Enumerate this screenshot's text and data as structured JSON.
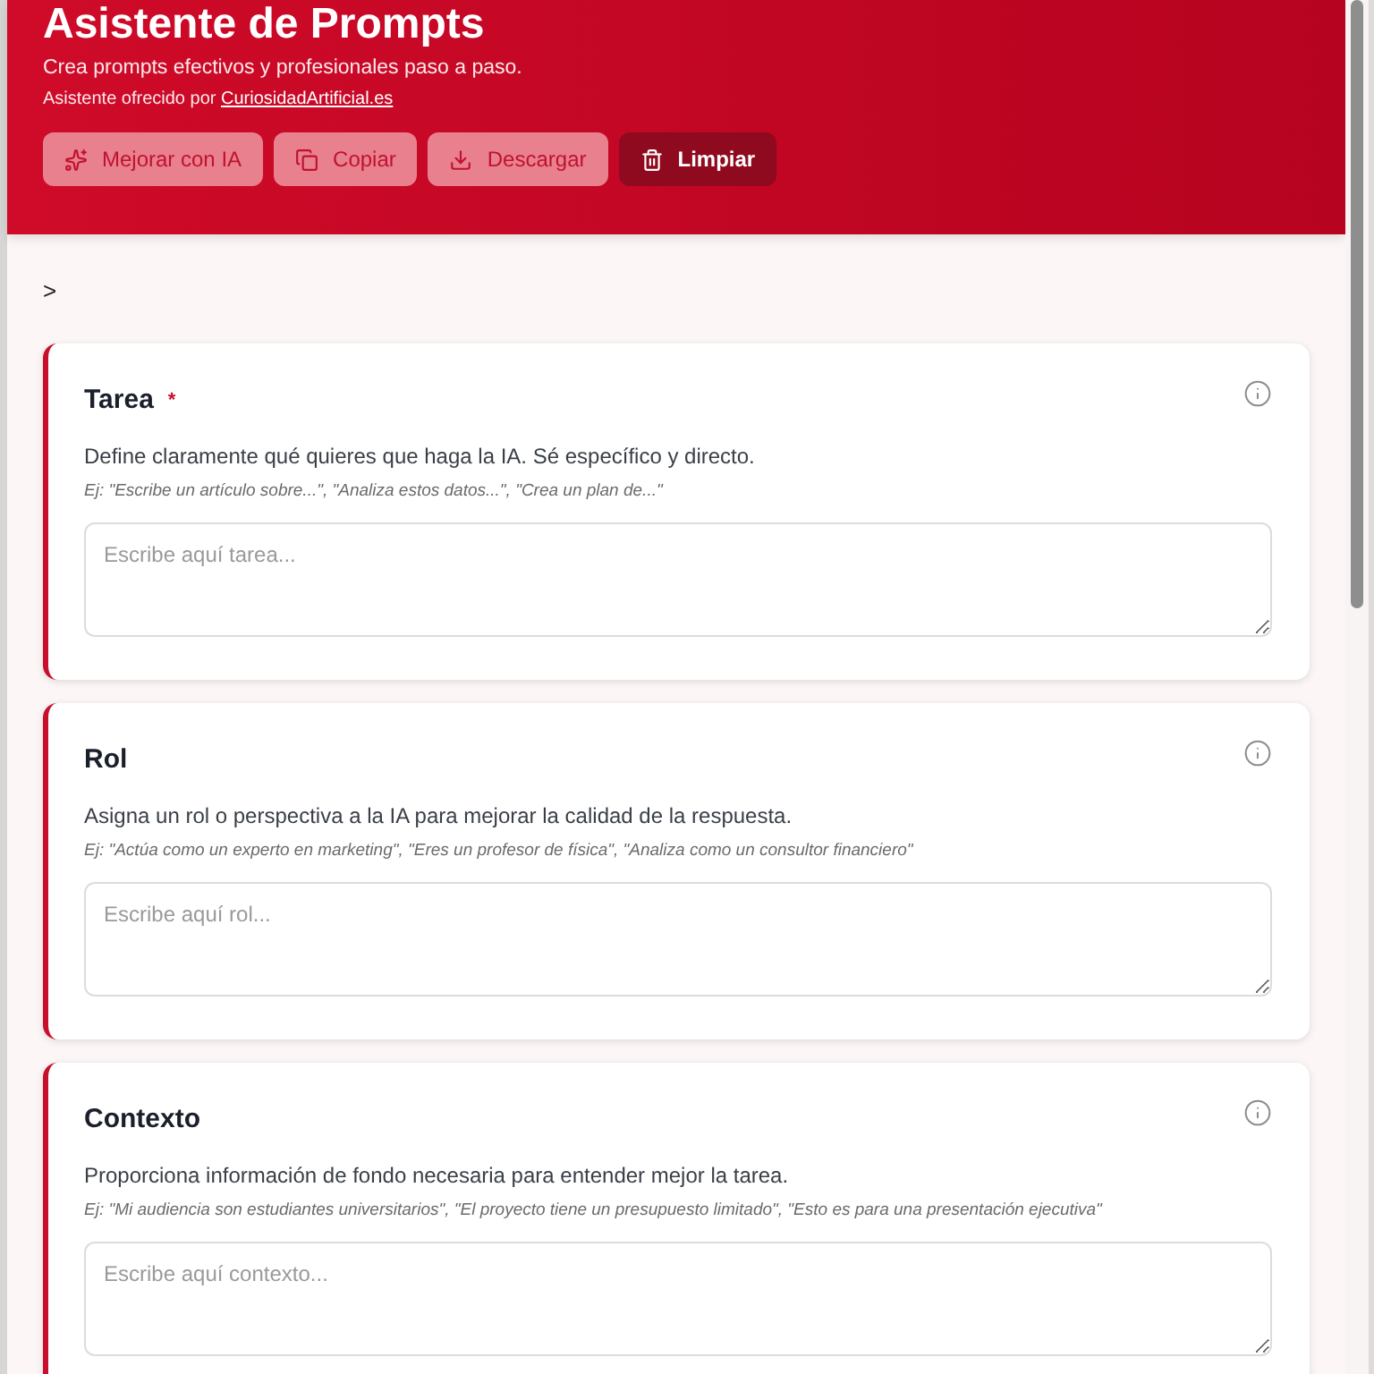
{
  "header": {
    "title": "Asistente de Prompts",
    "subtitle": "Crea prompts efectivos y profesionales paso a paso.",
    "credit": {
      "text": "Asistente ofrecido por",
      "link": "CuriosidadArtificial.es"
    },
    "buttons": [
      {
        "label": "Mejorar con IA",
        "kind": "sparkle"
      },
      {
        "label": "Copiar",
        "kind": "copy"
      },
      {
        "label": "Descargar",
        "kind": "download"
      },
      {
        "label": "Limpiar",
        "kind": "trash"
      }
    ]
  },
  "toggle": ">",
  "required_marker": "*",
  "sections": [
    {
      "title": "Tarea",
      "required": true,
      "description": "Define claramente qué quieres que haga la IA. Sé específico y directo.",
      "example": "Ej: \"Escribe un artículo sobre...\", \"Analiza estos datos...\", \"Crea un plan de...\"",
      "placeholder": "Escribe aquí tarea..."
    },
    {
      "title": "Rol",
      "required": false,
      "description": "Asigna un rol o perspectiva a la IA para mejorar la calidad de la respuesta.",
      "example": "Ej: \"Actúa como un experto en marketing\", \"Eres un profesor de física\", \"Analiza como un consultor financiero\"",
      "placeholder": "Escribe aquí rol..."
    },
    {
      "title": "Contexto",
      "required": false,
      "description": "Proporciona información de fondo necesaria para entender mejor la tarea.",
      "example": "Ej: \"Mi audiencia son estudiantes universitarios\", \"El proyecto tiene un presupuesto limitado\", \"Esto es para una presentación ejecutiva\"",
      "placeholder": "Escribe aquí contexto..."
    }
  ]
}
